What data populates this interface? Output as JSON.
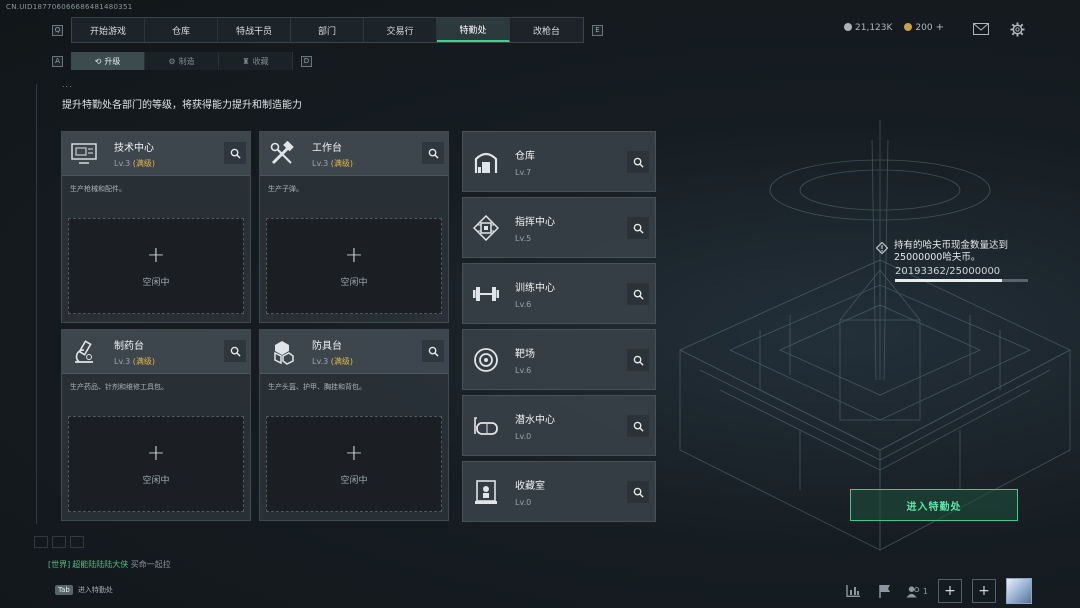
{
  "uid": "CN.UID187706066686481480351",
  "nav": {
    "key_left": "Q",
    "key_right": "E",
    "tabs": [
      "开始游戏",
      "仓库",
      "特战干员",
      "部门",
      "交易行",
      "特勤处",
      "改枪台"
    ],
    "active": "特勤处"
  },
  "sub_nav": {
    "key_left": "A",
    "key_right": "D",
    "tabs": [
      {
        "label": "升级",
        "icon": "upgrade-icon",
        "active": true
      },
      {
        "label": "制造",
        "icon": "craft-icon",
        "active": false
      },
      {
        "label": "收藏",
        "icon": "collection-icon",
        "active": false
      }
    ]
  },
  "currency": {
    "silver": "21,123K",
    "gold": "200",
    "gold_plus": "+"
  },
  "page": {
    "ellipsis": "...",
    "description": "提升特勤处各部门的等级，将获得能力提升和制造能力"
  },
  "big_cards": [
    {
      "title": "技术中心",
      "level": "Lv.3",
      "max": "(满级)",
      "desc": "生产枪械和配件。",
      "slot_plus": "+",
      "slot_status": "空闲中",
      "icon": "tech-center-icon"
    },
    {
      "title": "工作台",
      "level": "Lv.3",
      "max": "(满级)",
      "desc": "生产子弹。",
      "slot_plus": "+",
      "slot_status": "空闲中",
      "icon": "workbench-icon"
    },
    {
      "title": "制药台",
      "level": "Lv.3",
      "max": "(满级)",
      "desc": "生产药品、针剂和维修工具包。",
      "slot_plus": "+",
      "slot_status": "空闲中",
      "icon": "pharmacy-icon"
    },
    {
      "title": "防具台",
      "level": "Lv.3",
      "max": "(满级)",
      "desc": "生产头盔、护甲、胸挂和背包。",
      "slot_plus": "+",
      "slot_status": "空闲中",
      "icon": "armor-bench-icon"
    }
  ],
  "small_cards": [
    {
      "title": "仓库",
      "level": "Lv.7",
      "icon": "warehouse-icon"
    },
    {
      "title": "指挥中心",
      "level": "Lv.5",
      "icon": "command-center-icon"
    },
    {
      "title": "训练中心",
      "level": "Lv.6",
      "icon": "training-center-icon"
    },
    {
      "title": "靶场",
      "level": "Lv.6",
      "icon": "shooting-range-icon"
    },
    {
      "title": "潜水中心",
      "level": "Lv.0",
      "icon": "diving-center-icon"
    },
    {
      "title": "收藏室",
      "level": "Lv.0",
      "icon": "collection-room-icon"
    }
  ],
  "quest": {
    "text": "持有的哈夫币现金数量达到25000000哈夫币。",
    "progress_text": "20193362/25000000",
    "progress": 0.8077
  },
  "enter_button": "进入特勤处",
  "chat": {
    "channel": "[世界]",
    "sender": "超能陆陆陆大侠",
    "message": "买命一起拉"
  },
  "bottom_hint": {
    "key": "Tab",
    "label": "进入特勤处"
  },
  "bottom_bar": {
    "friends_count": "1",
    "plus": "+"
  },
  "colors": {
    "accent": "#3ed28e",
    "max_level": "#e3b64a"
  }
}
